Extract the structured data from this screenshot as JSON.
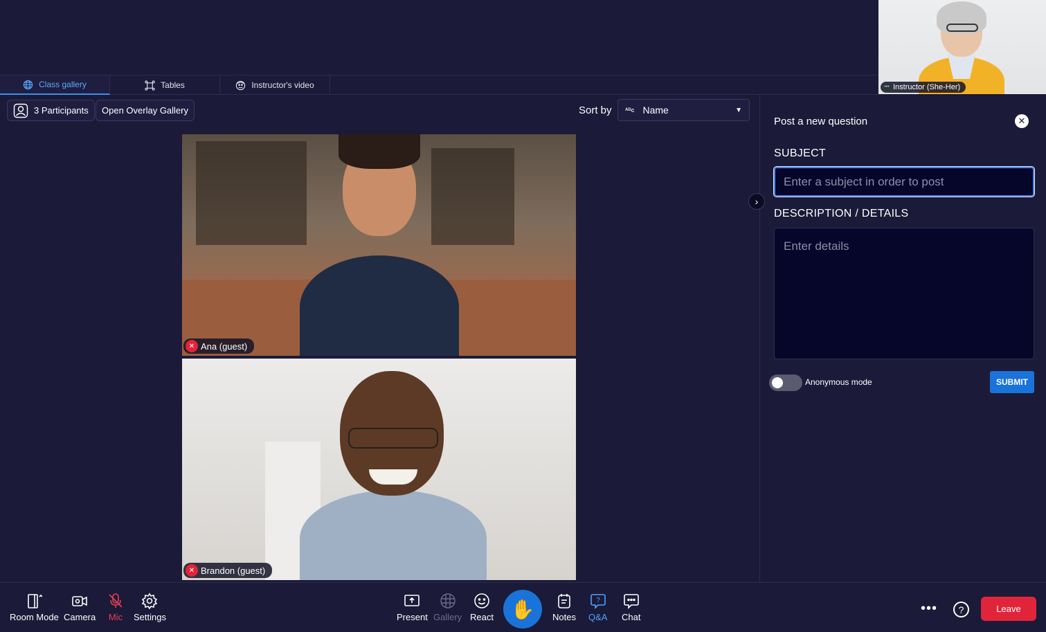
{
  "instructor": {
    "name": "Instructor (She-Her)"
  },
  "tabs": [
    {
      "label": "Class gallery",
      "icon": "globe-icon",
      "active": true
    },
    {
      "label": "Tables",
      "icon": "tables-icon",
      "active": false
    },
    {
      "label": "Instructor's video",
      "icon": "instructor-icon",
      "active": false
    }
  ],
  "gallery": {
    "participants_label": "3 Participants",
    "overlay_label": "Open Overlay Gallery",
    "sort_by_label": "Sort by",
    "sort_value": "Name",
    "sort_icon_text": "ᴬᴮc"
  },
  "tiles": [
    {
      "name": "Ana (guest)",
      "mic": "muted"
    },
    {
      "name": "Brandon (guest)",
      "mic": "muted"
    }
  ],
  "qa_panel": {
    "title": "Post a new question",
    "subject_label": "SUBJECT",
    "subject_placeholder": "Enter a subject in order to post",
    "details_label": "DESCRIPTION / DETAILS",
    "details_placeholder": "Enter details",
    "anonymous_label": "Anonymous mode",
    "anonymous_on": false,
    "submit_label": "SUBMIT"
  },
  "toolbar": {
    "room_mode": "Room Mode",
    "camera": "Camera",
    "mic": "Mic",
    "settings": "Settings",
    "present": "Present",
    "gallery": "Gallery",
    "react": "React",
    "notes": "Notes",
    "qa": "Q&A",
    "chat": "Chat",
    "more": "•••",
    "help": "?",
    "leave": "Leave"
  },
  "colors": {
    "background": "#1b1a38",
    "accent_blue": "#1a73d8",
    "active_tab": "#5aa8ff",
    "danger": "#e0253a"
  }
}
